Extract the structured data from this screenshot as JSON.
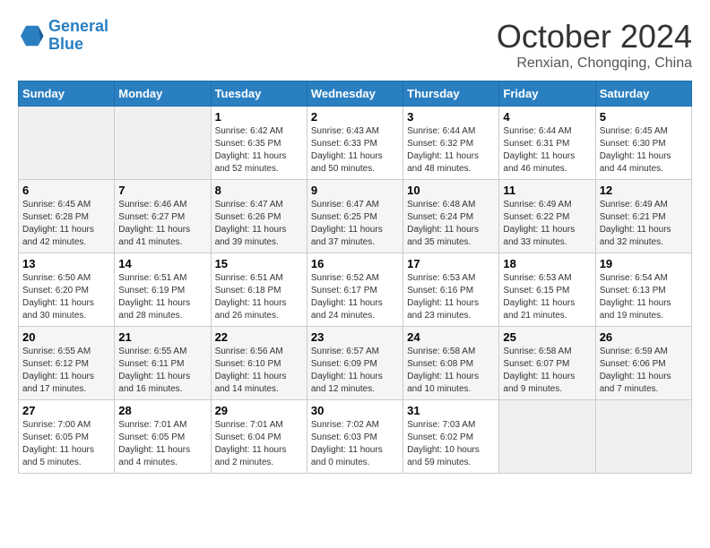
{
  "header": {
    "logo": {
      "line1": "General",
      "line2": "Blue"
    },
    "title": "October 2024",
    "location": "Renxian, Chongqing, China"
  },
  "weekdays": [
    "Sunday",
    "Monday",
    "Tuesday",
    "Wednesday",
    "Thursday",
    "Friday",
    "Saturday"
  ],
  "weeks": [
    [
      {
        "day": "",
        "empty": true
      },
      {
        "day": "",
        "empty": true
      },
      {
        "day": "1",
        "sunrise": "6:42 AM",
        "sunset": "6:35 PM",
        "daylight": "11 hours and 52 minutes."
      },
      {
        "day": "2",
        "sunrise": "6:43 AM",
        "sunset": "6:33 PM",
        "daylight": "11 hours and 50 minutes."
      },
      {
        "day": "3",
        "sunrise": "6:44 AM",
        "sunset": "6:32 PM",
        "daylight": "11 hours and 48 minutes."
      },
      {
        "day": "4",
        "sunrise": "6:44 AM",
        "sunset": "6:31 PM",
        "daylight": "11 hours and 46 minutes."
      },
      {
        "day": "5",
        "sunrise": "6:45 AM",
        "sunset": "6:30 PM",
        "daylight": "11 hours and 44 minutes."
      }
    ],
    [
      {
        "day": "6",
        "sunrise": "6:45 AM",
        "sunset": "6:28 PM",
        "daylight": "11 hours and 42 minutes."
      },
      {
        "day": "7",
        "sunrise": "6:46 AM",
        "sunset": "6:27 PM",
        "daylight": "11 hours and 41 minutes."
      },
      {
        "day": "8",
        "sunrise": "6:47 AM",
        "sunset": "6:26 PM",
        "daylight": "11 hours and 39 minutes."
      },
      {
        "day": "9",
        "sunrise": "6:47 AM",
        "sunset": "6:25 PM",
        "daylight": "11 hours and 37 minutes."
      },
      {
        "day": "10",
        "sunrise": "6:48 AM",
        "sunset": "6:24 PM",
        "daylight": "11 hours and 35 minutes."
      },
      {
        "day": "11",
        "sunrise": "6:49 AM",
        "sunset": "6:22 PM",
        "daylight": "11 hours and 33 minutes."
      },
      {
        "day": "12",
        "sunrise": "6:49 AM",
        "sunset": "6:21 PM",
        "daylight": "11 hours and 32 minutes."
      }
    ],
    [
      {
        "day": "13",
        "sunrise": "6:50 AM",
        "sunset": "6:20 PM",
        "daylight": "11 hours and 30 minutes."
      },
      {
        "day": "14",
        "sunrise": "6:51 AM",
        "sunset": "6:19 PM",
        "daylight": "11 hours and 28 minutes."
      },
      {
        "day": "15",
        "sunrise": "6:51 AM",
        "sunset": "6:18 PM",
        "daylight": "11 hours and 26 minutes."
      },
      {
        "day": "16",
        "sunrise": "6:52 AM",
        "sunset": "6:17 PM",
        "daylight": "11 hours and 24 minutes."
      },
      {
        "day": "17",
        "sunrise": "6:53 AM",
        "sunset": "6:16 PM",
        "daylight": "11 hours and 23 minutes."
      },
      {
        "day": "18",
        "sunrise": "6:53 AM",
        "sunset": "6:15 PM",
        "daylight": "11 hours and 21 minutes."
      },
      {
        "day": "19",
        "sunrise": "6:54 AM",
        "sunset": "6:13 PM",
        "daylight": "11 hours and 19 minutes."
      }
    ],
    [
      {
        "day": "20",
        "sunrise": "6:55 AM",
        "sunset": "6:12 PM",
        "daylight": "11 hours and 17 minutes."
      },
      {
        "day": "21",
        "sunrise": "6:55 AM",
        "sunset": "6:11 PM",
        "daylight": "11 hours and 16 minutes."
      },
      {
        "day": "22",
        "sunrise": "6:56 AM",
        "sunset": "6:10 PM",
        "daylight": "11 hours and 14 minutes."
      },
      {
        "day": "23",
        "sunrise": "6:57 AM",
        "sunset": "6:09 PM",
        "daylight": "11 hours and 12 minutes."
      },
      {
        "day": "24",
        "sunrise": "6:58 AM",
        "sunset": "6:08 PM",
        "daylight": "11 hours and 10 minutes."
      },
      {
        "day": "25",
        "sunrise": "6:58 AM",
        "sunset": "6:07 PM",
        "daylight": "11 hours and 9 minutes."
      },
      {
        "day": "26",
        "sunrise": "6:59 AM",
        "sunset": "6:06 PM",
        "daylight": "11 hours and 7 minutes."
      }
    ],
    [
      {
        "day": "27",
        "sunrise": "7:00 AM",
        "sunset": "6:05 PM",
        "daylight": "11 hours and 5 minutes."
      },
      {
        "day": "28",
        "sunrise": "7:01 AM",
        "sunset": "6:05 PM",
        "daylight": "11 hours and 4 minutes."
      },
      {
        "day": "29",
        "sunrise": "7:01 AM",
        "sunset": "6:04 PM",
        "daylight": "11 hours and 2 minutes."
      },
      {
        "day": "30",
        "sunrise": "7:02 AM",
        "sunset": "6:03 PM",
        "daylight": "11 hours and 0 minutes."
      },
      {
        "day": "31",
        "sunrise": "7:03 AM",
        "sunset": "6:02 PM",
        "daylight": "10 hours and 59 minutes."
      },
      {
        "day": "",
        "empty": true
      },
      {
        "day": "",
        "empty": true
      }
    ]
  ],
  "labels": {
    "sunrise": "Sunrise:",
    "sunset": "Sunset:",
    "daylight": "Daylight:"
  }
}
